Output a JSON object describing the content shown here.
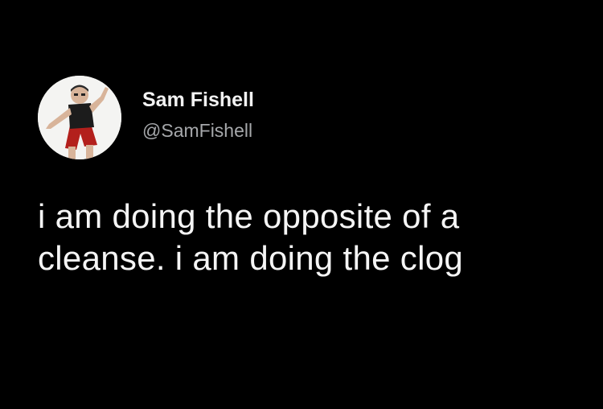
{
  "tweet": {
    "author": {
      "display_name": "Sam Fishell",
      "handle": "@SamFishell",
      "avatar_icon": "person-dancing-avatar"
    },
    "text_lines": [
      "i am doing the opposite of a",
      "cleanse. i am doing the clog"
    ]
  },
  "colors": {
    "background": "#000000",
    "name": "#f2f2f2",
    "handle": "#a6a8ab",
    "body_text": "#f5f5f5"
  }
}
